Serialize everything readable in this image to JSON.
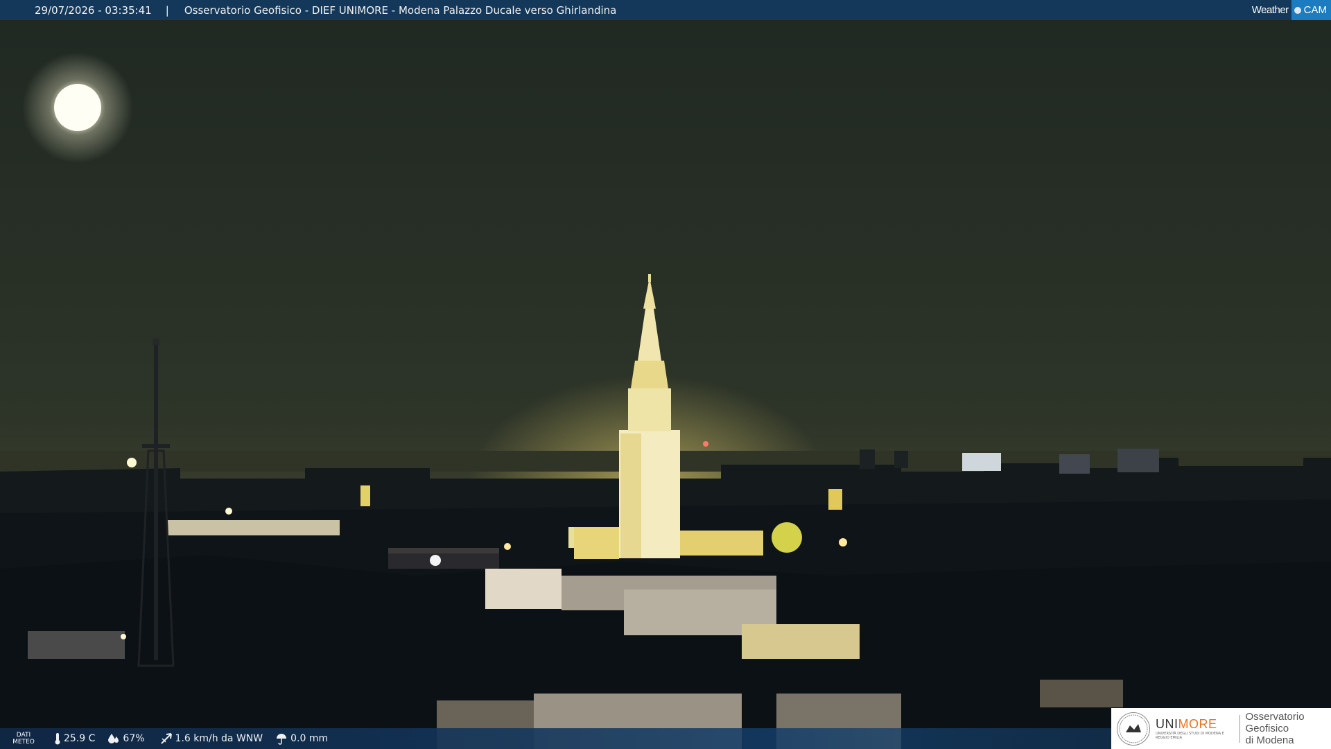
{
  "header": {
    "timestamp": "29/07/2026 - 03:35:41",
    "separator": "|",
    "title": "Osservatorio Geofisico - DIEF UNIMORE - Modena Palazzo Ducale verso Ghirlandina"
  },
  "brand": {
    "weather": "Weather",
    "cam": "CAM"
  },
  "meteo": {
    "label": "DATI METEO",
    "temperature": "25.9 C",
    "humidity": "67%",
    "wind": "1.6 km/h da WNW",
    "rain": "0.0 mm"
  },
  "logo": {
    "unimore_a": "UNI",
    "unimore_b": "MORE",
    "unimore_sub": "UNIVERSITÀ DEGLI STUDI DI MODENA E REGGIO EMILIA",
    "org_line1": "Osservatorio Geofisico",
    "org_line2": "di Modena"
  },
  "colors": {
    "sky": "#2a3226",
    "tower_light": "#fff6c8",
    "bar": "#143a5f",
    "accent": "#e8731e"
  }
}
